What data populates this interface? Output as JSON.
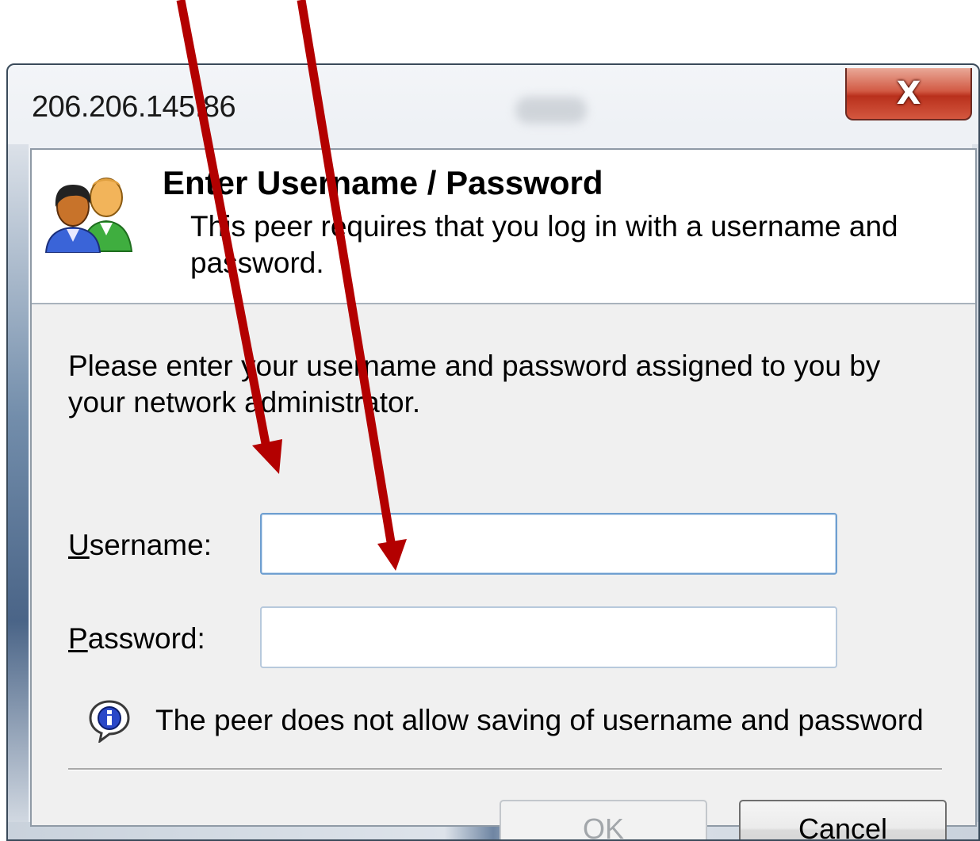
{
  "window": {
    "title": "206.206.145.86",
    "close_glyph": "X"
  },
  "header": {
    "title": "Enter Username / Password",
    "description": "This peer requires that you log in with a username and password.",
    "icon": "users-icon"
  },
  "body": {
    "instructions": "Please enter your username and password assigned to you by your network administrator."
  },
  "username": {
    "label_accel": "U",
    "label_rest": "sername:",
    "value": ""
  },
  "password": {
    "label_accel": "P",
    "label_rest": "assword:",
    "value": ""
  },
  "info": {
    "icon": "info-icon",
    "text": "The peer does not allow saving of username and password"
  },
  "buttons": {
    "ok_label": "OK",
    "ok_enabled": false,
    "cancel_label": "Cancel"
  },
  "annotations": {
    "arrow_color": "#b30000"
  },
  "colors": {
    "close_button": "#c43a24",
    "input_focus_border": "#6f9fd0"
  }
}
